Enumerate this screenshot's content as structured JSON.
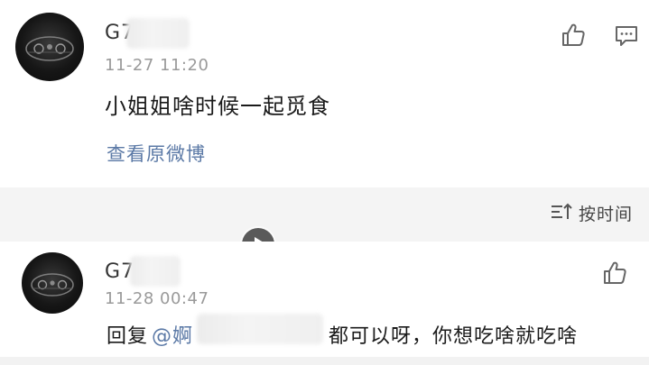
{
  "comment": {
    "username": "G7",
    "timestamp": "11-27 11:20",
    "text": "小姐姐啥时候一起觅食",
    "view_original": "查看原微博"
  },
  "sort": {
    "label": "按时间"
  },
  "reply": {
    "username": "G7",
    "timestamp": "11-28 00:47",
    "prefix": "回复",
    "mention": "@婀",
    "text": "都可以呀，你想吃啥就吃啥"
  },
  "icons": {
    "like": "thumbs-up-icon",
    "comment": "comment-bubble-icon",
    "sort": "sort-lines-icon",
    "play": "play-icon"
  }
}
